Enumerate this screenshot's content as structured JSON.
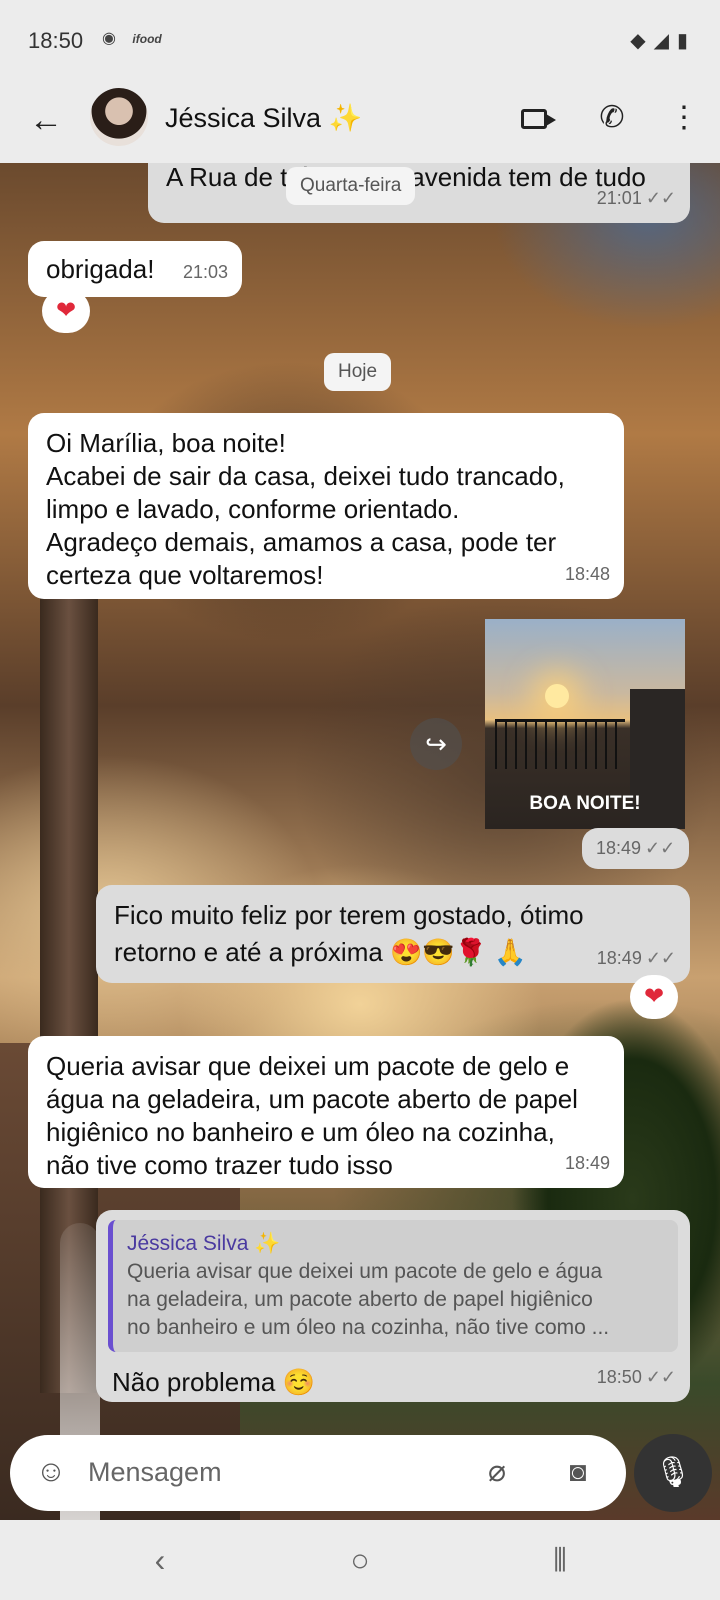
{
  "status": {
    "time": "18:50",
    "left_icons": [
      "whatsapp-icon",
      "ifood-icon"
    ],
    "right_icons": [
      "wifi-icon",
      "signal-icon",
      "battery-icon"
    ]
  },
  "header": {
    "contact_name": "Jéssica Silva",
    "contact_emoji": "✨"
  },
  "messages": {
    "partial_prev": {
      "text": "A Rua de trás e uma avenida tem de tudo",
      "time": "21:01",
      "ticks": "✓✓"
    },
    "date_wed": "Quarta-feira",
    "obrigada": {
      "text": "obrigada!",
      "time": "21:03",
      "reaction": "❤"
    },
    "date_today": "Hoje",
    "msg1": {
      "lines": [
        "Oi Marília, boa noite!",
        "Acabei de sair da casa, deixei tudo trancado,",
        "limpo e lavado, conforme orientado.",
        "Agradeço demais, amamos a casa, pode ter",
        "certeza que voltaremos!"
      ],
      "time": "18:48"
    },
    "image": {
      "caption": "BOA NOITE!",
      "time": "18:49",
      "ticks": "✓✓"
    },
    "msg2": {
      "lines": [
        "Fico muito feliz por terem gostado, ótimo",
        "retorno e até a próxima 😍😎🌹 🙏"
      ],
      "time": "18:49",
      "ticks": "✓✓",
      "reaction": "❤"
    },
    "msg3": {
      "lines": [
        "Queria avisar que deixei um pacote de gelo e",
        "água na geladeira, um pacote aberto de papel",
        "higiênico no banheiro e um óleo na cozinha,",
        "não tive como trazer tudo isso"
      ],
      "time": "18:49"
    },
    "msg4": {
      "quote_name": "Jéssica Silva ✨",
      "quote_lines": [
        "Queria avisar que deixei um pacote de gelo e água",
        "na geladeira, um pacote aberto de papel higiênico",
        "no banheiro e um óleo na cozinha, não tive como ..."
      ],
      "text": "Não problema ☺️",
      "time": "18:50",
      "ticks": "✓✓"
    }
  },
  "input": {
    "placeholder": "Mensagem"
  },
  "colors": {
    "accent_quote": "#6a4fd0",
    "reaction": "#e0283a"
  }
}
